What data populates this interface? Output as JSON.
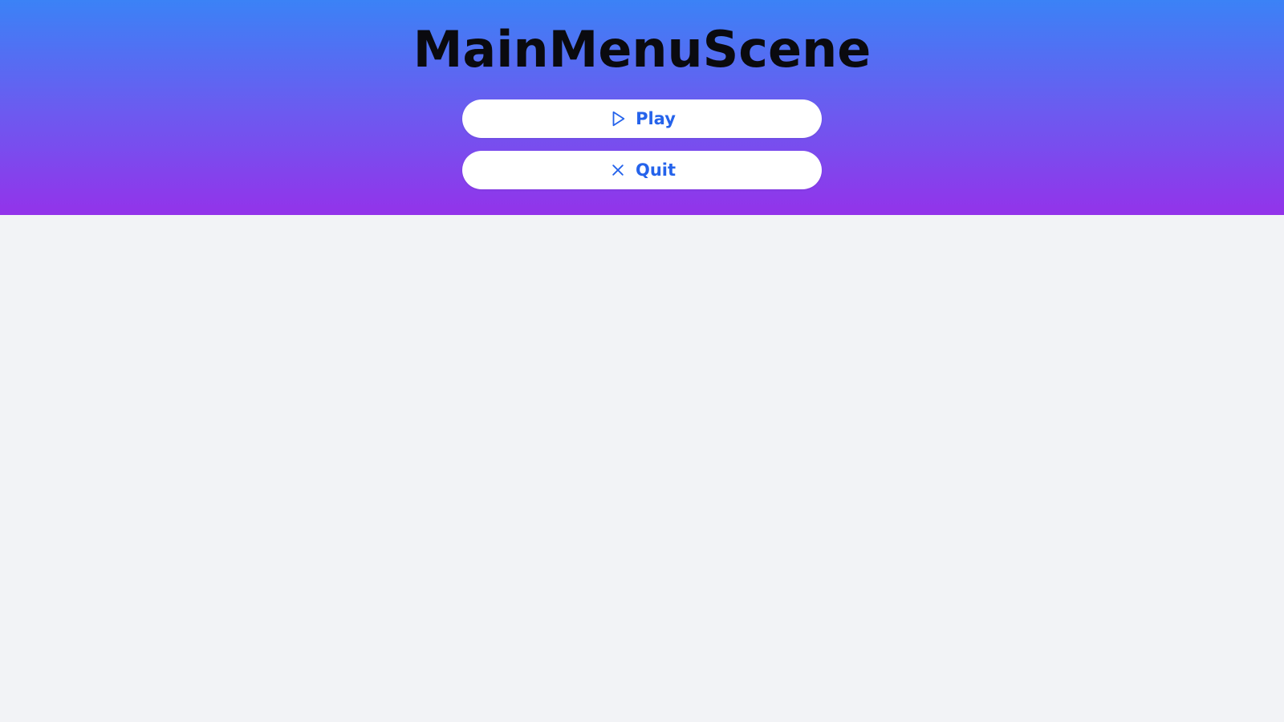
{
  "scene": {
    "title": "MainMenuScene"
  },
  "menu": {
    "buttons": [
      {
        "label": "Play",
        "icon": "play-icon"
      },
      {
        "label": "Quit",
        "icon": "close-icon"
      }
    ]
  },
  "colors": {
    "header_gradient_top": "#3b82f6",
    "header_gradient_bottom": "#9333ea",
    "button_text": "#2563eb",
    "button_bg": "#ffffff",
    "page_bg": "#f2f3f6",
    "title_text": "#0a0a0f"
  }
}
